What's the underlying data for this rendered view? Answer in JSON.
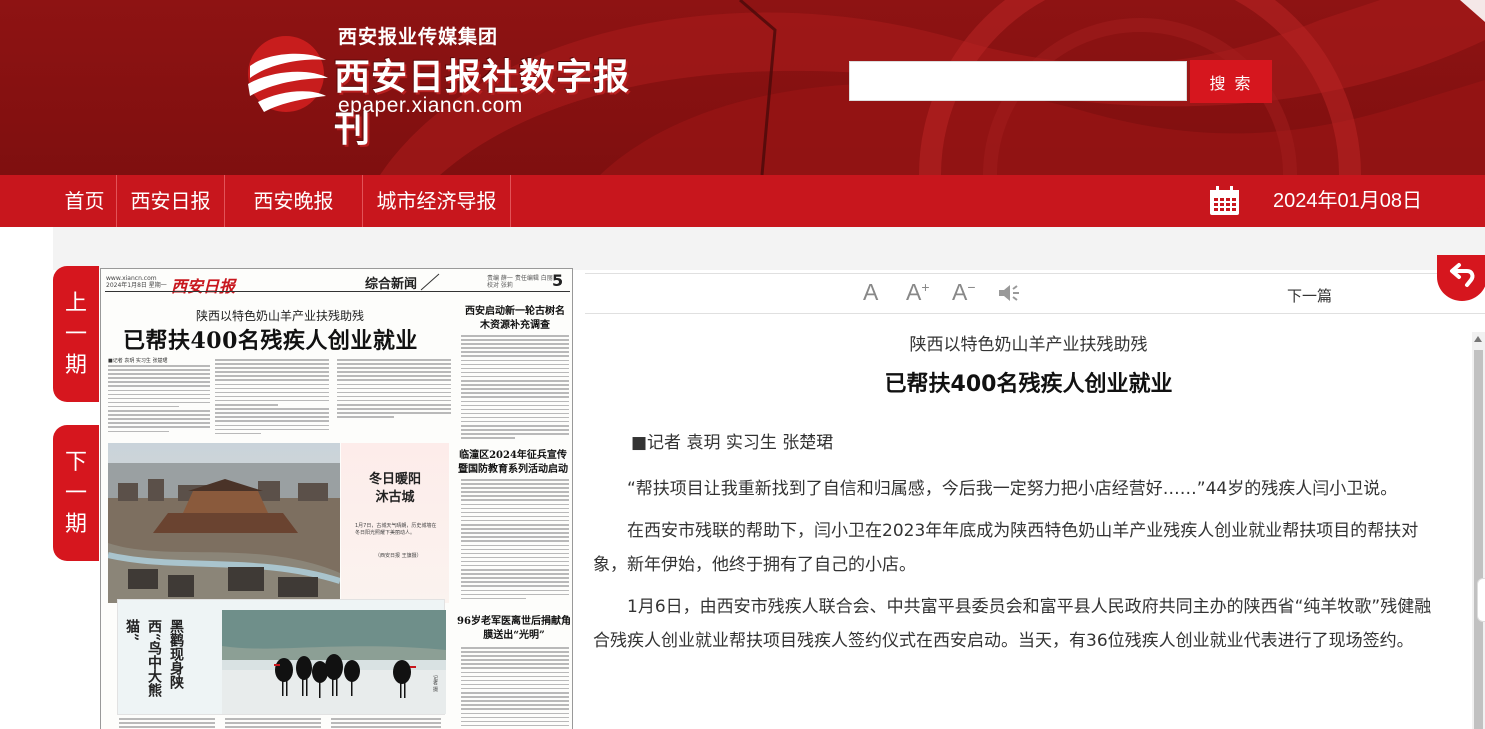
{
  "header": {
    "logo_group": "西安报业传媒集团",
    "logo_title": "西安日报社数字报刊",
    "logo_url": "epaper.xiancn.com",
    "search": {
      "placeholder": "",
      "value": "",
      "button_label": "搜 索"
    }
  },
  "nav": {
    "items": [
      {
        "label": "首页"
      },
      {
        "label": "西安日报"
      },
      {
        "label": "西安晚报"
      },
      {
        "label": "城市经济导报"
      }
    ],
    "date": "2024年01月08日"
  },
  "side_tabs": {
    "prev": [
      "上",
      "一",
      "期"
    ],
    "next": [
      "下",
      "一",
      "期"
    ]
  },
  "newspaper_page": {
    "header_left": [
      "www.xiancn.com",
      "2024年1月8日 星期一"
    ],
    "masthead": "西安日报",
    "section": "综合新闻",
    "header_right": [
      "责编 薛一 责任编辑 白丽",
      "校对 张莉"
    ],
    "page_number": "5",
    "kicker": "陕西以特色奶山羊产业扶残助残",
    "headline": "已帮扶400名残疾人创业就业",
    "byline": "■记者 袁玥 实习生 张楚珺",
    "right_story_1": "西安启动新一轮古树名木资源补充调查",
    "right_story_2": "临潼区2024年征兵宣传暨国防教育系列活动启动",
    "right_story_3": "96岁老军医离世后捐献角膜送出“光明”",
    "photo_title": "冬日暖阳沐古城",
    "photo_caption": "1月7日，古城天气晴朗，历史城墙在冬日阳光照耀下美丽动人。",
    "photo_credit": "（西安日报 王旗摄）",
    "bird_title": "黑鹳现身陕西“鸟中大熊猫”",
    "bird_caption": "记者 摄"
  },
  "article_tools": {
    "font_default": "A",
    "font_up": "A",
    "font_up_sup": "+",
    "font_down": "A",
    "font_down_sup": "−",
    "next_label": "下一篇"
  },
  "article": {
    "kicker": "陕西以特色奶山羊产业扶残助残",
    "title": "已帮扶400名残疾人创业就业",
    "byline": "■记者 袁玥 实习生 张楚珺",
    "paragraphs": [
      "“帮扶项目让我重新找到了自信和归属感，今后我一定努力把小店经营好……”44岁的残疾人闫小卫说。",
      "在西安市残联的帮助下，闫小卫在2023年年底成为陕西特色奶山羊产业残疾人创业就业帮扶项目的帮扶对象，新年伊始，他终于拥有了自己的小店。",
      "1月6日，由西安市残疾人联合会、中共富平县委员会和富平县人民政府共同主办的陕西省“纯羊牧歌”残健融合残疾人创业就业帮扶项目残疾人签约仪式在西安启动。当天，有36位残疾人创业就业代表进行了现场签约。"
    ]
  },
  "colors": {
    "banner": "#8e1313",
    "nav": "#c8161d",
    "accent": "#d6161e"
  },
  "icons": {
    "calendar": "calendar-icon",
    "speaker": "speaker-icon",
    "back": "back-arrow-icon"
  }
}
